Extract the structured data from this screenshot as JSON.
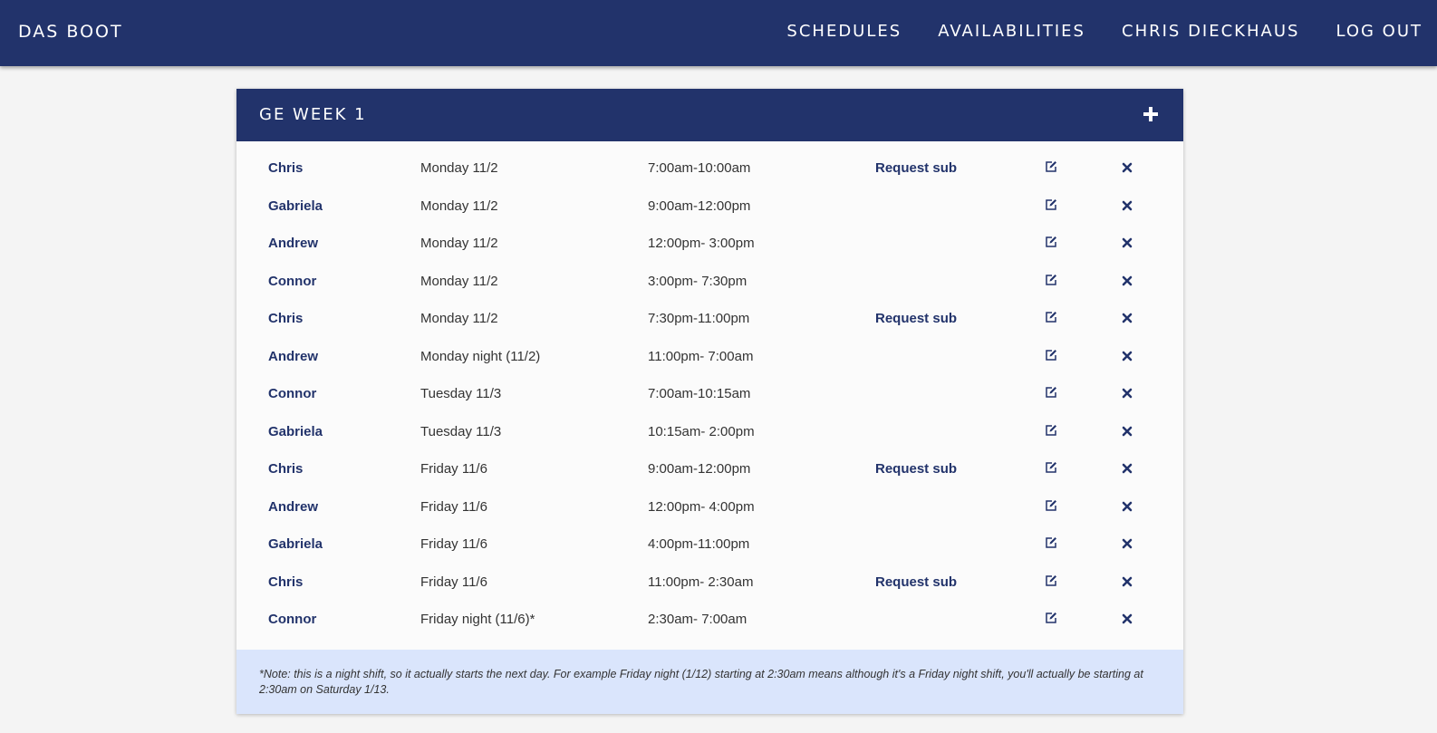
{
  "nav": {
    "brand": "DAS BOOT",
    "links": [
      "SCHEDULES",
      "AVAILABILITIES",
      "CHRIS DIECKHAUS",
      "LOG OUT"
    ]
  },
  "panel": {
    "title": "GE WEEK 1",
    "add_icon": "plus-icon",
    "edit_icon": "edit-icon",
    "delete_icon": "close-icon",
    "accent_color": "#22336b",
    "note_background": "#dae5fc",
    "shifts": [
      {
        "name": "Chris",
        "day": "Monday 11/2",
        "time": "7:00am-10:00am",
        "sub": "Request sub"
      },
      {
        "name": "Gabriela",
        "day": "Monday 11/2",
        "time": "9:00am-12:00pm",
        "sub": ""
      },
      {
        "name": "Andrew",
        "day": "Monday 11/2",
        "time": "12:00pm- 3:00pm",
        "sub": ""
      },
      {
        "name": "Connor",
        "day": "Monday 11/2",
        "time": "3:00pm- 7:30pm",
        "sub": ""
      },
      {
        "name": "Chris",
        "day": "Monday 11/2",
        "time": "7:30pm-11:00pm",
        "sub": "Request sub"
      },
      {
        "name": "Andrew",
        "day": "Monday night (11/2)",
        "time": "11:00pm- 7:00am",
        "sub": ""
      },
      {
        "name": "Connor",
        "day": "Tuesday 11/3",
        "time": "7:00am-10:15am",
        "sub": ""
      },
      {
        "name": "Gabriela",
        "day": "Tuesday 11/3",
        "time": "10:15am- 2:00pm",
        "sub": ""
      },
      {
        "name": "Chris",
        "day": "Friday 11/6",
        "time": "9:00am-12:00pm",
        "sub": "Request sub"
      },
      {
        "name": "Andrew",
        "day": "Friday 11/6",
        "time": "12:00pm- 4:00pm",
        "sub": ""
      },
      {
        "name": "Gabriela",
        "day": "Friday 11/6",
        "time": "4:00pm-11:00pm",
        "sub": ""
      },
      {
        "name": "Chris",
        "day": "Friday 11/6",
        "time": "11:00pm- 2:30am",
        "sub": "Request sub"
      },
      {
        "name": "Connor",
        "day": "Friday night (11/6)*",
        "time": "2:30am- 7:00am",
        "sub": ""
      }
    ],
    "note": "*Note: this is a night shift, so it actually starts the next day. For example Friday night (1/12) starting at 2:30am means although it's a Friday night shift, you'll actually be starting at 2:30am on Saturday 1/13."
  }
}
